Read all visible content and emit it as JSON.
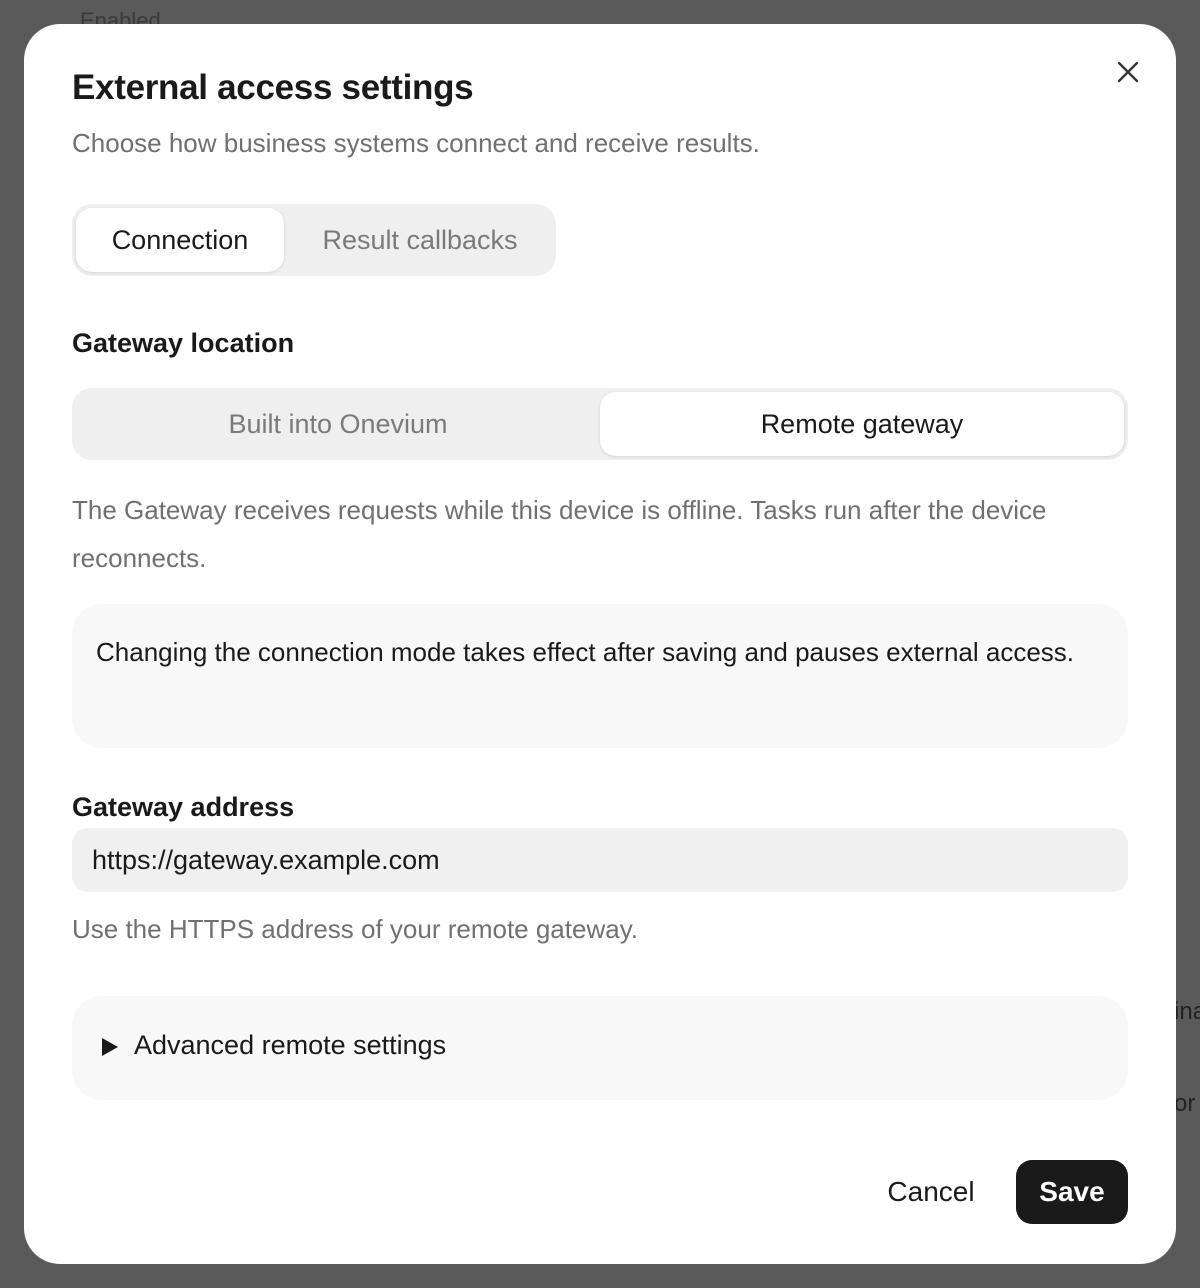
{
  "background": {
    "top_text": "Enabled",
    "right_fragment_1": "ina",
    "right_fragment_2": "or"
  },
  "dialog": {
    "title": "External access settings",
    "subtitle": "Choose how business systems connect and receive results.",
    "close_icon": "close-icon"
  },
  "tabs": [
    {
      "label": "Connection",
      "active": true
    },
    {
      "label": "Result callbacks",
      "active": false
    }
  ],
  "gateway_location": {
    "label": "Gateway location",
    "options": [
      {
        "label": "Built into Onevium",
        "selected": false
      },
      {
        "label": "Remote gateway",
        "selected": true
      }
    ],
    "description": "The Gateway receives requests while this device is offline. Tasks run after the device reconnects."
  },
  "notice": "Changing the connection mode takes effect after saving and pauses external access.",
  "gateway_address": {
    "label": "Gateway address",
    "value": "https://gateway.example.com",
    "helper": "Use the HTTPS address of your remote gateway."
  },
  "advanced": {
    "label": "Advanced remote settings",
    "icon": "triangle-right-icon"
  },
  "footer": {
    "cancel_label": "Cancel",
    "save_label": "Save"
  },
  "colors": {
    "overlay": "#5a5a5a",
    "primary_button": "#1a1a1a",
    "muted_text": "#707070",
    "surface": "#efefef"
  }
}
